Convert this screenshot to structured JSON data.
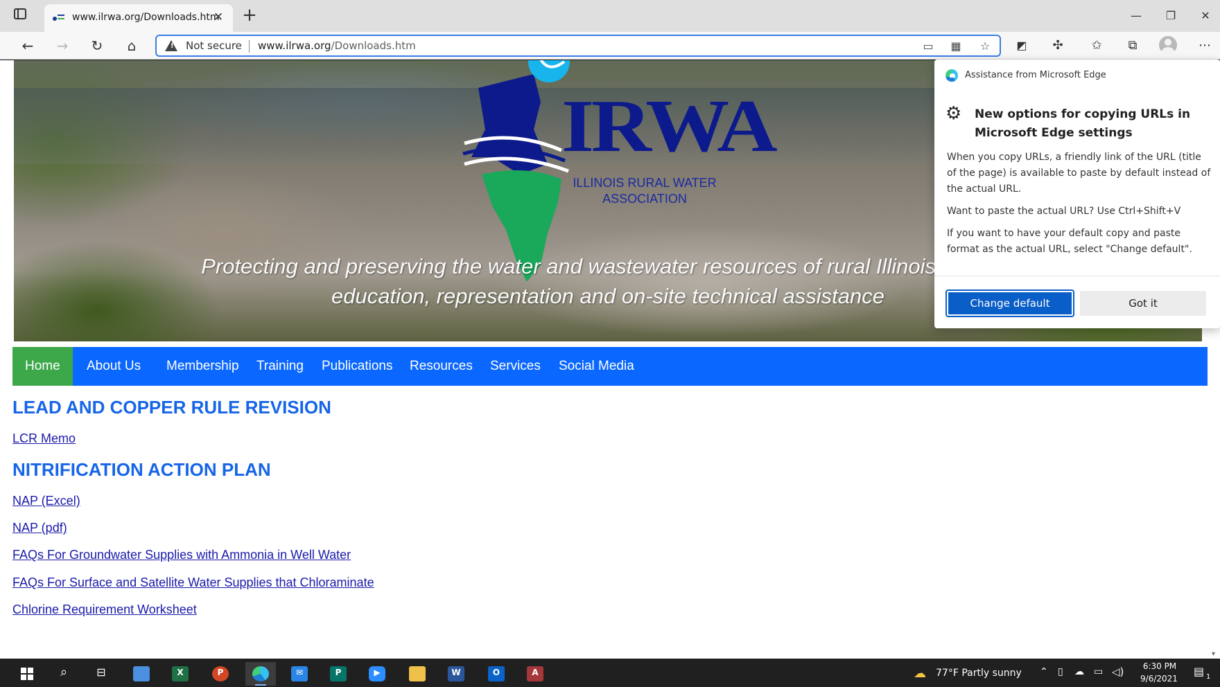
{
  "browser": {
    "tab_title": "www.ilrwa.org/Downloads.htm",
    "security_label": "Not secure",
    "url_host": "www.ilrwa.org",
    "url_path": "/Downloads.htm"
  },
  "banner": {
    "logo_text": "IRWA",
    "logo_subtitle_line1": "ILLINOIS RURAL WATER",
    "logo_subtitle_line2": "ASSOCIATION",
    "tagline_line1": "Protecting and preserving the water and wastewater resources of rural Illinois through",
    "tagline_line2": "education, representation and on-site technical assistance"
  },
  "nav": {
    "items": [
      {
        "label": "Home",
        "active": true
      },
      {
        "label": "About Us"
      },
      {
        "label": "Membership"
      },
      {
        "label": "Training"
      },
      {
        "label": "Publications"
      },
      {
        "label": "Resources"
      },
      {
        "label": "Services"
      },
      {
        "label": "Social Media"
      }
    ]
  },
  "content": {
    "section1_heading": "LEAD AND COPPER RULE REVISION",
    "section1_links": [
      "LCR Memo"
    ],
    "section2_heading": "NITRIFICATION ACTION PLAN",
    "section2_links": [
      "NAP (Excel)",
      "NAP (pdf)",
      "FAQs For Groundwater Supplies with Ammonia in Well Water",
      "FAQs For Surface and Satellite Water Supplies that Chloraminate",
      "Chlorine Requirement Worksheet"
    ]
  },
  "popup": {
    "header": "Assistance from Microsoft Edge",
    "title": "New options for copying URLs in Microsoft Edge settings",
    "para1": "When you copy URLs, a friendly link of the URL (title of the page) is available to paste by default instead of the actual URL.",
    "para2": "Want to paste the actual URL? Use Ctrl+Shift+V",
    "para3": "If you want to have your default copy and paste format as the actual URL, select \"Change default\".",
    "primary_button": "Change default",
    "secondary_button": "Got it"
  },
  "taskbar": {
    "weather": "77°F  Partly sunny",
    "time": "6:30 PM",
    "date": "9/6/2021",
    "notification_count": "1"
  },
  "colors": {
    "nav_bg": "#0a67ff",
    "nav_active": "#3da84a",
    "heading": "#1665e8",
    "link": "#1a1aaa",
    "popup_primary": "#0a5ec8"
  }
}
